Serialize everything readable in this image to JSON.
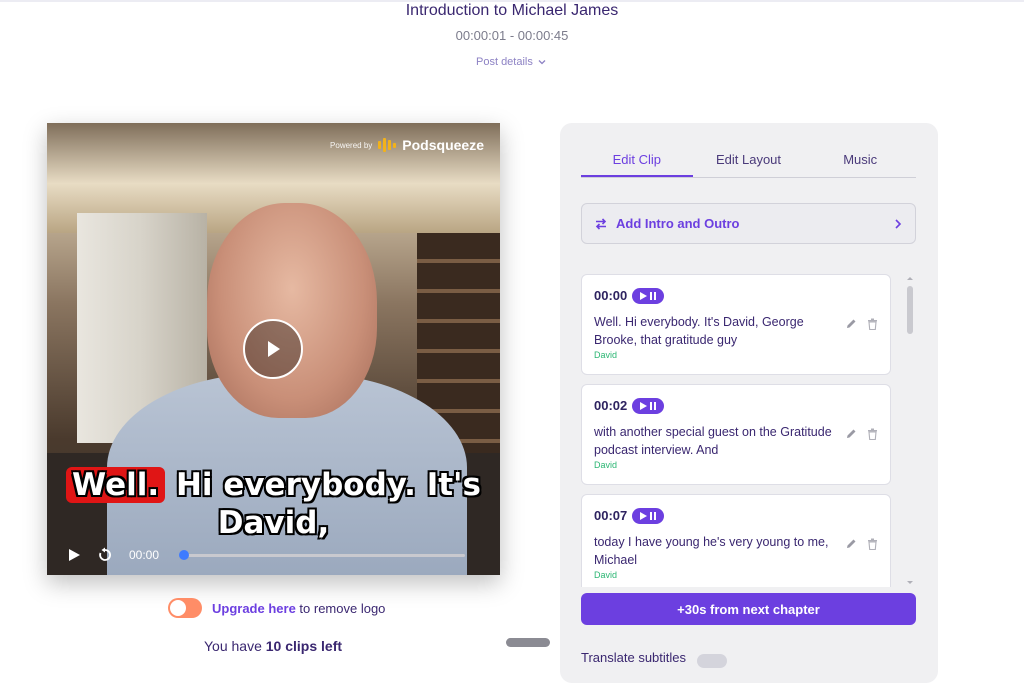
{
  "header": {
    "title": "Introduction to Michael James",
    "time_range": "00:00:01 - 00:00:45",
    "post_details": "Post details"
  },
  "video": {
    "powered_by": "Powered by",
    "brand": "Podsqueeze",
    "caption_highlight": "Well.",
    "caption_rest": " Hi everybody. It's David,",
    "current_time": "00:00",
    "progress": 0
  },
  "logo_row": {
    "upgrade_link": "Upgrade here",
    "suffix": " to remove logo"
  },
  "clips_left": {
    "prefix": "You have ",
    "count": "10 clips left"
  },
  "panel": {
    "tabs": [
      "Edit Clip",
      "Edit Layout",
      "Music"
    ],
    "active_tab": 0,
    "intro_button": "Add Intro and Outro",
    "segments": [
      {
        "time": "00:00",
        "text": "Well. Hi everybody. It's David, George Brooke, that gratitude guy",
        "speaker": "David"
      },
      {
        "time": "00:02",
        "text": "with another special guest on the Gratitude podcast interview. And",
        "speaker": "David"
      },
      {
        "time": "00:07",
        "text": "today I have young he's very young to me, Michael",
        "speaker": "David"
      }
    ],
    "next_button": "+30s from next chapter",
    "bottom_label": "Translate subtitles"
  },
  "colors": {
    "accent": "#6c3fe0",
    "toggle_on": "#ff8d67",
    "speaker": "#2bb673",
    "caption_highlight": "#e01515"
  }
}
